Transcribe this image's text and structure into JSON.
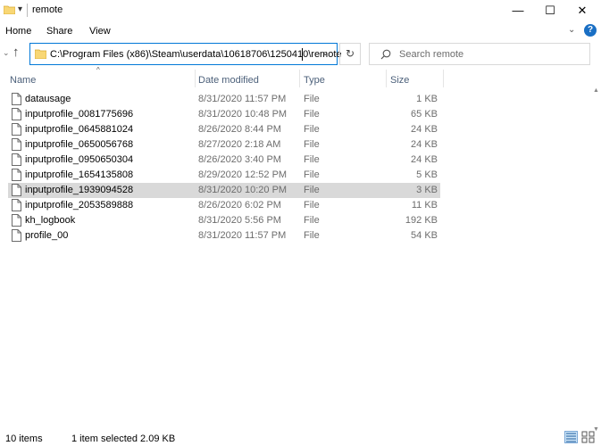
{
  "window": {
    "title": "remote",
    "quick_access_arrow": "▾",
    "minimize": "—",
    "maximize": "☐",
    "close": "✕"
  },
  "ribbon": {
    "tabs": [
      "Home",
      "Share",
      "View"
    ],
    "expand_chevron": "⌄",
    "help": "?"
  },
  "nav": {
    "back": "‹",
    "forward": "›",
    "up": "↑",
    "address": "C:\\Program Files (x86)\\Steam\\userdata\\10618706\\1250410\\remote",
    "address_dropdown": "⌄",
    "refresh": "↻",
    "search_placeholder": "Search remote"
  },
  "columns": {
    "name": "Name",
    "date": "Date modified",
    "type": "Type",
    "size": "Size",
    "sort_indicator": "^"
  },
  "files": [
    {
      "name": "datausage",
      "date": "8/31/2020 11:57 PM",
      "type": "File",
      "size": "1 KB",
      "selected": false
    },
    {
      "name": "inputprofile_0081775696",
      "date": "8/31/2020 10:48 PM",
      "type": "File",
      "size": "65 KB",
      "selected": false
    },
    {
      "name": "inputprofile_0645881024",
      "date": "8/26/2020 8:44 PM",
      "type": "File",
      "size": "24 KB",
      "selected": false
    },
    {
      "name": "inputprofile_0650056768",
      "date": "8/27/2020 2:18 AM",
      "type": "File",
      "size": "24 KB",
      "selected": false
    },
    {
      "name": "inputprofile_0950650304",
      "date": "8/26/2020 3:40 PM",
      "type": "File",
      "size": "24 KB",
      "selected": false
    },
    {
      "name": "inputprofile_1654135808",
      "date": "8/29/2020 12:52 PM",
      "type": "File",
      "size": "5 KB",
      "selected": false
    },
    {
      "name": "inputprofile_1939094528",
      "date": "8/31/2020 10:20 PM",
      "type": "File",
      "size": "3 KB",
      "selected": true
    },
    {
      "name": "inputprofile_2053589888",
      "date": "8/26/2020 6:02 PM",
      "type": "File",
      "size": "11 KB",
      "selected": false
    },
    {
      "name": "kh_logbook",
      "date": "8/31/2020 5:56 PM",
      "type": "File",
      "size": "192 KB",
      "selected": false
    },
    {
      "name": "profile_00",
      "date": "8/31/2020 11:57 PM",
      "type": "File",
      "size": "54 KB",
      "selected": false
    }
  ],
  "status": {
    "item_count": "10 items",
    "selection": "1 item selected  2.09 KB"
  },
  "colors": {
    "accent": "#0078d7",
    "selected_row": "#d9d9d9",
    "header_text": "#4c607a",
    "secondary_text": "#6d6d6d"
  }
}
